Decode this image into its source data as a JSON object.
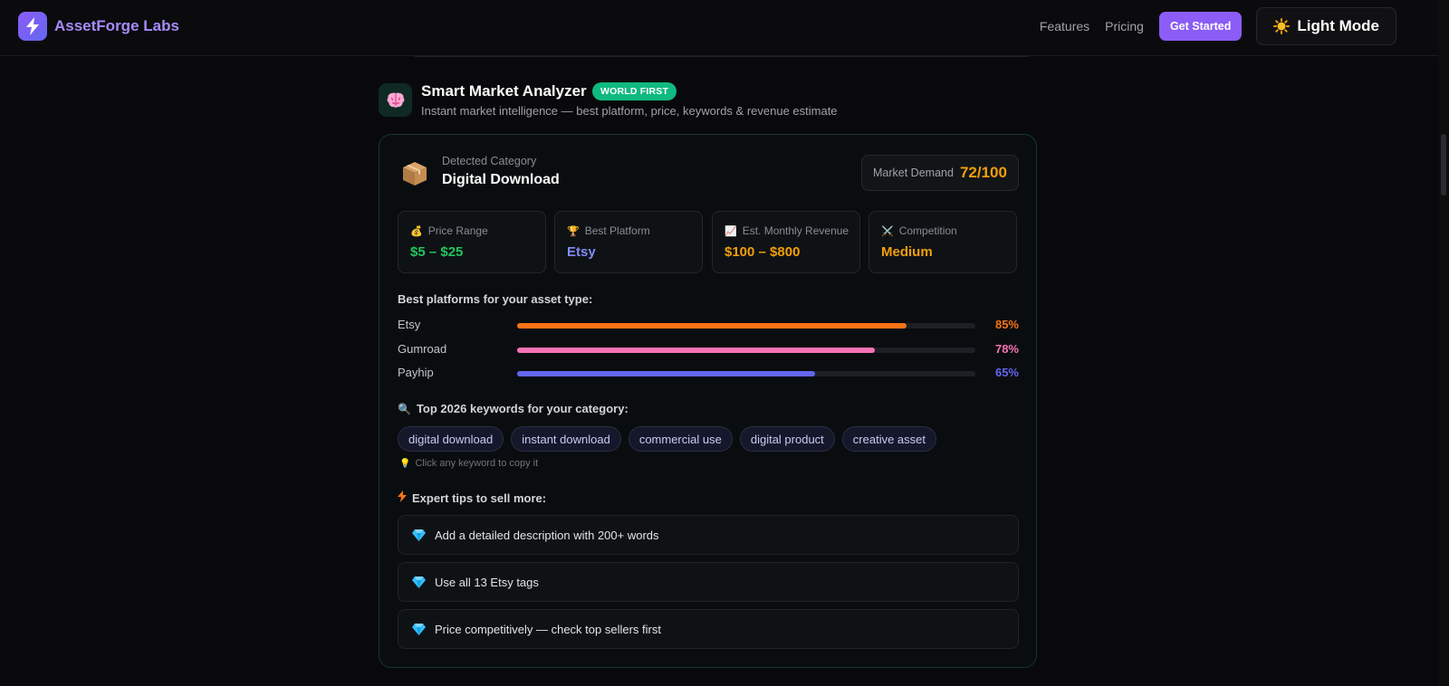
{
  "navbar": {
    "brand_name": "AssetForge Labs",
    "links": [
      "Features",
      "Pricing"
    ],
    "cta_label": "Get Started",
    "theme_toggle_label": "Light Mode"
  },
  "header": {
    "title": "Smart Market Analyzer",
    "badge": "WORLD FIRST",
    "subtitle": "Instant market intelligence — best platform, price, keywords & revenue estimate"
  },
  "category": {
    "label": "Detected Category",
    "value": "Digital Download",
    "icon": "package-icon"
  },
  "demand": {
    "label": "Market Demand",
    "value": "72/100"
  },
  "stats": [
    {
      "icon": "money-bag-icon",
      "label": "Price Range",
      "value": "$5 – $25",
      "color": "#22c55e"
    },
    {
      "icon": "trophy-icon",
      "label": "Best Platform",
      "value": "Etsy",
      "color": "#818cf8"
    },
    {
      "icon": "chart-up-icon",
      "label": "Est. Monthly Revenue",
      "value": "$100 – $800",
      "color": "#f59e0b"
    },
    {
      "icon": "crossed-swords-icon",
      "label": "Competition",
      "value": "Medium",
      "color": "#f59e0b"
    }
  ],
  "platforms": {
    "title": "Best platforms for your asset type:",
    "items": [
      {
        "name": "Etsy",
        "percent": 85,
        "percent_label": "85%",
        "color": "#f97316"
      },
      {
        "name": "Gumroad",
        "percent": 78,
        "percent_label": "78%",
        "color": "#f472b6"
      },
      {
        "name": "Payhip",
        "percent": 65,
        "percent_label": "65%",
        "color": "#6366f1"
      }
    ]
  },
  "keywords": {
    "title": "Top 2026 keywords for your category:",
    "items": [
      "digital download",
      "instant download",
      "commercial use",
      "digital product",
      "creative asset"
    ],
    "hint": "Click any keyword to copy it"
  },
  "tips": {
    "title": "Expert tips to sell more:",
    "items": [
      "Add a detailed description with 200+ words",
      "Use all 13 Etsy tags",
      "Price competitively — check top sellers first"
    ]
  }
}
